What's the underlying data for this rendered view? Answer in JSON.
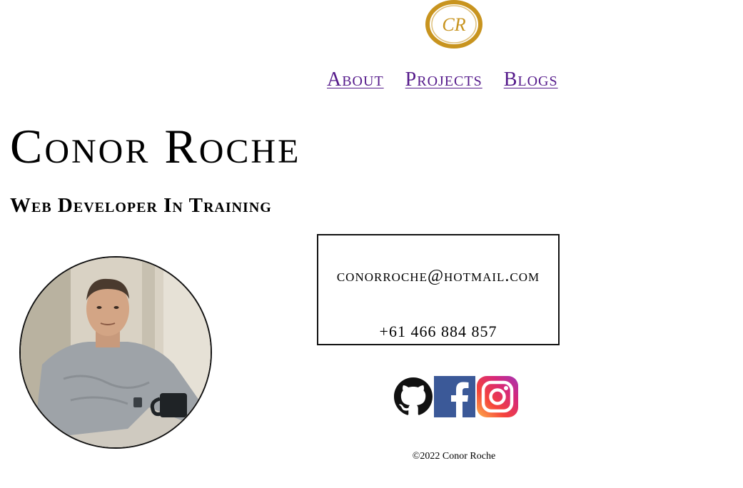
{
  "logo": {
    "text": "CR",
    "color": "#c8941f"
  },
  "nav": {
    "items": [
      {
        "label": "About"
      },
      {
        "label": "Projects"
      },
      {
        "label": "Blogs"
      }
    ],
    "link_color": "#551a8b"
  },
  "hero": {
    "name": "Conor Roche",
    "subtitle": "Web Developer In Training"
  },
  "contact": {
    "email": "conorroche@hotmail.com",
    "phone": "+61 466 884 857"
  },
  "socials": [
    {
      "icon": "github-icon"
    },
    {
      "icon": "facebook-icon",
      "color": "#3b5998"
    },
    {
      "icon": "instagram-icon"
    }
  ],
  "footer": {
    "copyright": "©2022 Conor Roche"
  }
}
